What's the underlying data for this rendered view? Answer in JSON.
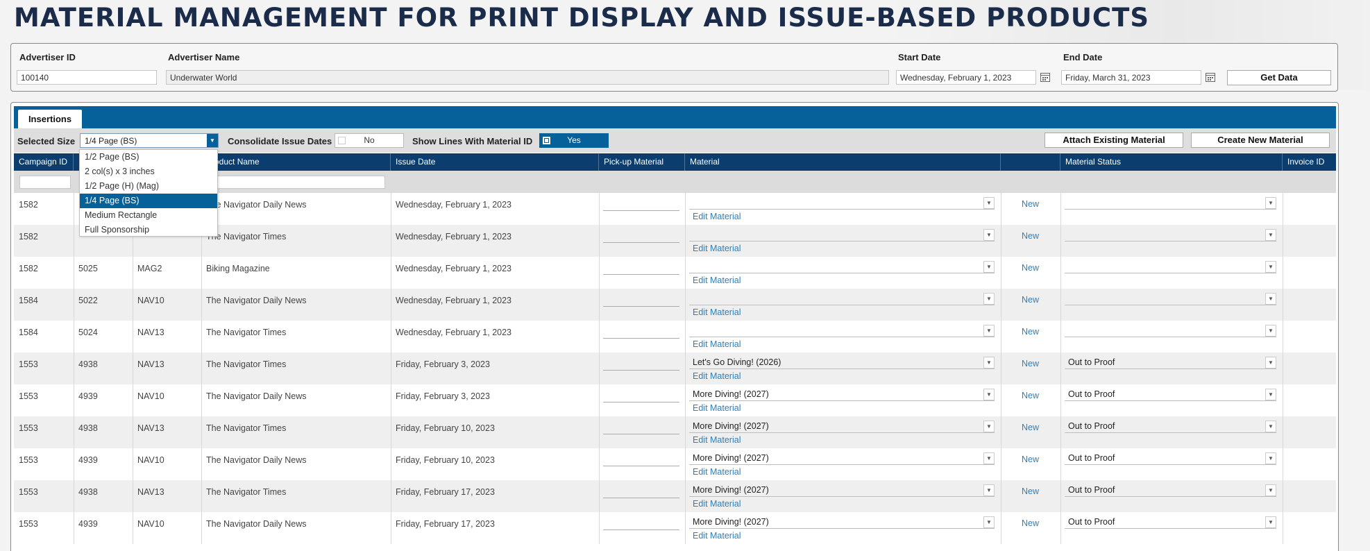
{
  "page_title": "MATERIAL MANAGEMENT FOR PRINT DISPLAY AND ISSUE-BASED PRODUCTS",
  "criteria": {
    "advertiser_id_label": "Advertiser ID",
    "advertiser_id_value": "100140",
    "advertiser_name_label": "Advertiser Name",
    "advertiser_name_value": "Underwater World",
    "start_date_label": "Start Date",
    "start_date_value": "Wednesday, February 1, 2023",
    "end_date_label": "End Date",
    "end_date_value": "Friday, March 31, 2023",
    "get_data_label": "Get Data"
  },
  "tabs": [
    {
      "label": "Insertions",
      "active": true
    }
  ],
  "toolbar": {
    "selected_size_label": "Selected Size",
    "selected_size_value": "1/4 Page (BS)",
    "consolidate_label": "Consolidate Issue Dates",
    "consolidate_value": "No",
    "show_lines_label": "Show Lines With Material ID",
    "show_lines_value": "Yes",
    "attach_label": "Attach Existing Material",
    "create_label": "Create New Material"
  },
  "size_options": [
    "1/2 Page (BS)",
    "2 col(s) x 3 inches",
    "1/2 Page (H) (Mag)",
    "1/4 Page (BS)",
    "Medium Rectangle",
    "Full Sponsorship"
  ],
  "selected_size_index": 3,
  "columns": [
    "Campaign ID",
    "",
    "",
    "Product Name",
    "Issue Date",
    "Pick-up Material",
    "Material",
    "",
    "Material Status",
    "Invoice ID"
  ],
  "edit_material_label": "Edit Material",
  "new_label": "New",
  "rows": [
    {
      "campaign": "1582",
      "order": "",
      "code": "",
      "product": "The Navigator Daily News",
      "issue_date": "Wednesday, February 1, 2023",
      "material": "",
      "status": ""
    },
    {
      "campaign": "1582",
      "order": "",
      "code": "",
      "product": "The Navigator Times",
      "issue_date": "Wednesday, February 1, 2023",
      "material": "",
      "status": ""
    },
    {
      "campaign": "1582",
      "order": "5025",
      "code": "MAG2",
      "product": "Biking Magazine",
      "issue_date": "Wednesday, February 1, 2023",
      "material": "",
      "status": ""
    },
    {
      "campaign": "1584",
      "order": "5022",
      "code": "NAV10",
      "product": "The Navigator Daily News",
      "issue_date": "Wednesday, February 1, 2023",
      "material": "",
      "status": ""
    },
    {
      "campaign": "1584",
      "order": "5024",
      "code": "NAV13",
      "product": "The Navigator Times",
      "issue_date": "Wednesday, February 1, 2023",
      "material": "",
      "status": ""
    },
    {
      "campaign": "1553",
      "order": "4938",
      "code": "NAV13",
      "product": "The Navigator Times",
      "issue_date": "Friday, February 3, 2023",
      "material": "Let's Go Diving! (2026)",
      "status": "Out to Proof"
    },
    {
      "campaign": "1553",
      "order": "4939",
      "code": "NAV10",
      "product": "The Navigator Daily News",
      "issue_date": "Friday, February 3, 2023",
      "material": "More Diving! (2027)",
      "status": "Out to Proof"
    },
    {
      "campaign": "1553",
      "order": "4938",
      "code": "NAV13",
      "product": "The Navigator Times",
      "issue_date": "Friday, February 10, 2023",
      "material": "More Diving! (2027)",
      "status": "Out to Proof"
    },
    {
      "campaign": "1553",
      "order": "4939",
      "code": "NAV10",
      "product": "The Navigator Daily News",
      "issue_date": "Friday, February 10, 2023",
      "material": "More Diving! (2027)",
      "status": "Out to Proof"
    },
    {
      "campaign": "1553",
      "order": "4938",
      "code": "NAV13",
      "product": "The Navigator Times",
      "issue_date": "Friday, February 17, 2023",
      "material": "More Diving! (2027)",
      "status": "Out to Proof"
    },
    {
      "campaign": "1553",
      "order": "4939",
      "code": "NAV10",
      "product": "The Navigator Daily News",
      "issue_date": "Friday, February 17, 2023",
      "material": "More Diving! (2027)",
      "status": "Out to Proof"
    }
  ]
}
